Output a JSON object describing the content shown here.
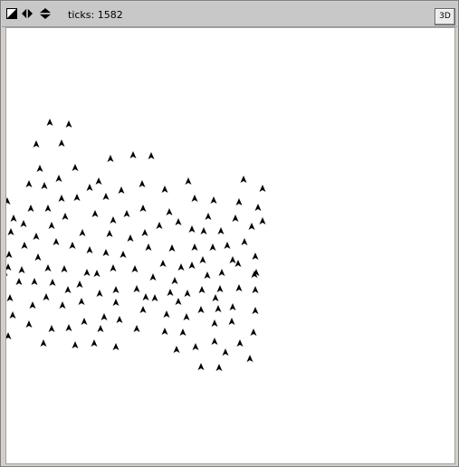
{
  "toolbar": {
    "ticks_label": "ticks: 1582",
    "view_mode_button": "3D",
    "icons": [
      "zoom-icon",
      "step-arrows-icon",
      "up-down-arrows-icon"
    ]
  },
  "world": {
    "background": "#ffffff",
    "agent_color": "#000000",
    "agent_shape": "arrowhead",
    "agent_heading": "north",
    "agents_visible": 170
  }
}
